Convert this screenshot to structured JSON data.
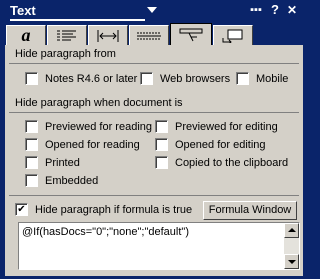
{
  "window": {
    "title": "Text",
    "buttons": [
      "minimize-dots",
      "help",
      "close"
    ],
    "help_label": "?",
    "close_label": "✕"
  },
  "tabs": [
    {
      "icon": "italic-a-icon",
      "label": "a",
      "active": false
    },
    {
      "icon": "paragraph-alignment-icon",
      "active": false
    },
    {
      "icon": "spacing-arrows-icon",
      "active": false
    },
    {
      "icon": "lines-icon",
      "active": false
    },
    {
      "icon": "hide-paragraph-icon",
      "active": true
    },
    {
      "icon": "style-icon",
      "active": false
    }
  ],
  "hide_from": {
    "header": "Hide paragraph from",
    "options": [
      {
        "label": "Notes R4.6 or later",
        "checked": false
      },
      {
        "label": "Web browsers",
        "checked": false
      },
      {
        "label": "Mobile",
        "checked": false
      }
    ]
  },
  "hide_when": {
    "header": "Hide paragraph when document is",
    "left": [
      {
        "label": "Previewed for reading",
        "checked": false
      },
      {
        "label": "Opened for reading",
        "checked": false
      },
      {
        "label": "Printed",
        "checked": false
      },
      {
        "label": "Embedded",
        "checked": false
      }
    ],
    "right": [
      {
        "label": "Previewed for editing",
        "checked": false
      },
      {
        "label": "Opened for editing",
        "checked": false
      },
      {
        "label": "Copied to the clipboard",
        "checked": false
      }
    ]
  },
  "formula": {
    "checkbox_label": "Hide paragraph if formula is true",
    "checked": true,
    "check_mark": "✔",
    "button_label": "Formula Window",
    "text": "@If(hasDocs=\"0\";\"none\";\"default\")"
  }
}
